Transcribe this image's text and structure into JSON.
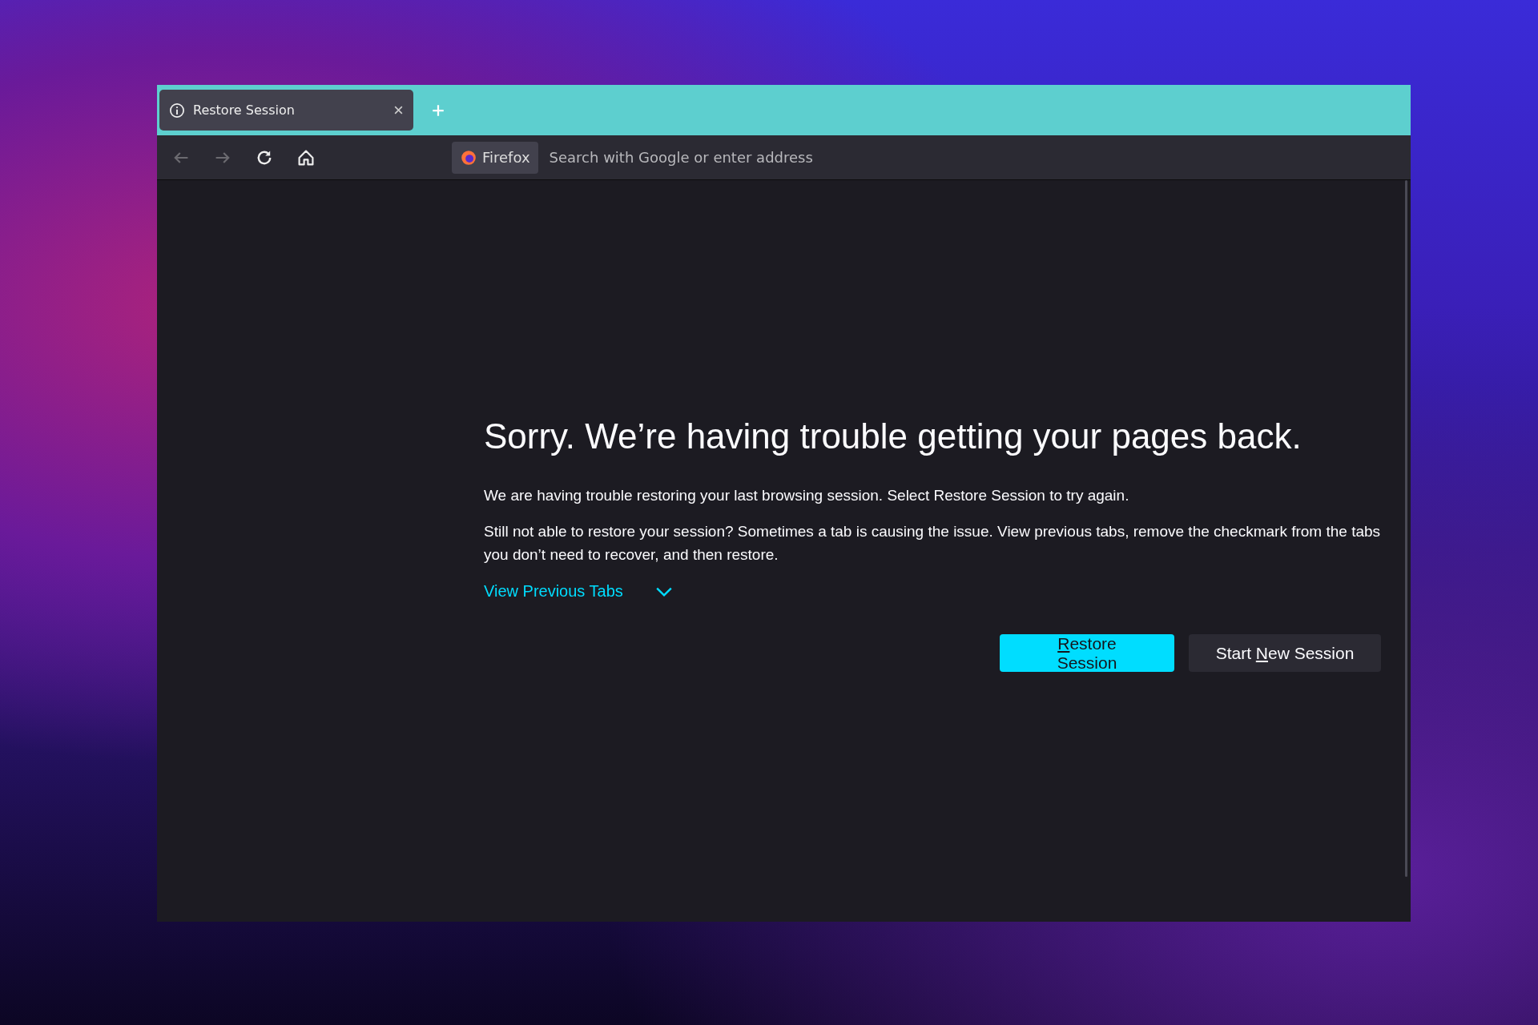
{
  "tabs": [
    {
      "label": "Restore Session",
      "selected": true
    }
  ],
  "toolbar": {
    "identity_label": "Firefox",
    "address_placeholder": "Search with Google or enter address"
  },
  "page": {
    "heading": "Sorry. We’re having trouble getting your pages back.",
    "paragraphs": [
      "We are having trouble restoring your last browsing session. Select Restore Session to try again.",
      "Still not able to restore your session? Sometimes a tab is causing the issue. View previous tabs, remove the checkmark from the tabs you don’t need to recover, and then restore."
    ],
    "toggle": {
      "label": "View Previous Tabs",
      "expanded": false
    },
    "buttons": [
      {
        "kind": "primary",
        "key": "R",
        "rest": "estore Session"
      },
      {
        "kind": "secondary",
        "before": "Start ",
        "key": "N",
        "rest": "ew Session"
      }
    ]
  }
}
